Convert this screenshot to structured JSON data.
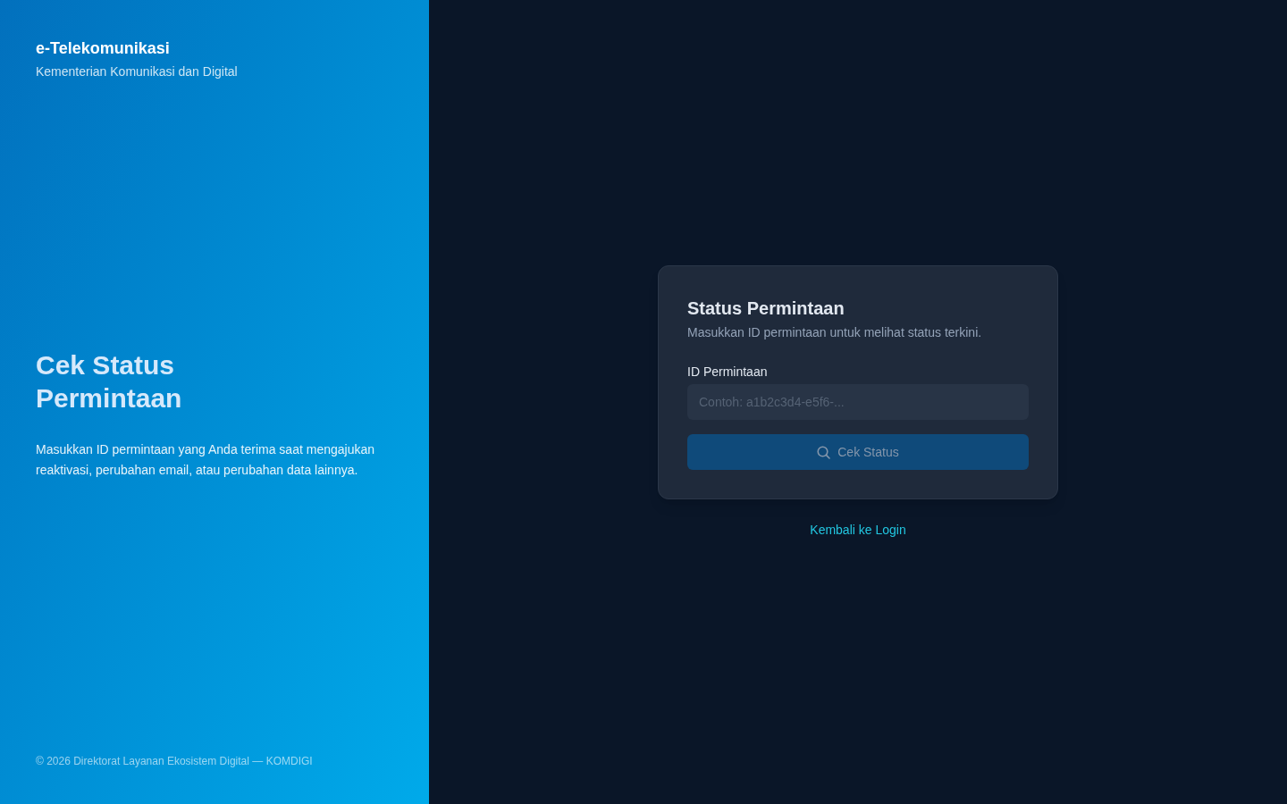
{
  "brand": {
    "title": "e-Telekomunikasi",
    "subtitle": "Kementerian Komunikasi dan Digital"
  },
  "hero": {
    "heading": "Cek Status Permintaan",
    "description": "Masukkan ID permintaan yang Anda terima saat mengajukan reaktivasi, perubahan email, atau perubahan data lainnya."
  },
  "footer": "© 2026 Direktorat Layanan Ekosistem Digital — KOMDIGI",
  "card": {
    "title": "Status Permintaan",
    "subtitle": "Masukkan ID permintaan untuk melihat status terkini.",
    "field": {
      "label": "ID Permintaan",
      "placeholder": "Contoh: a1b2c3d4-e5f6-..."
    },
    "button": {
      "label": "Cek Status",
      "disabled": true
    }
  },
  "back_link": "Kembali ke Login"
}
